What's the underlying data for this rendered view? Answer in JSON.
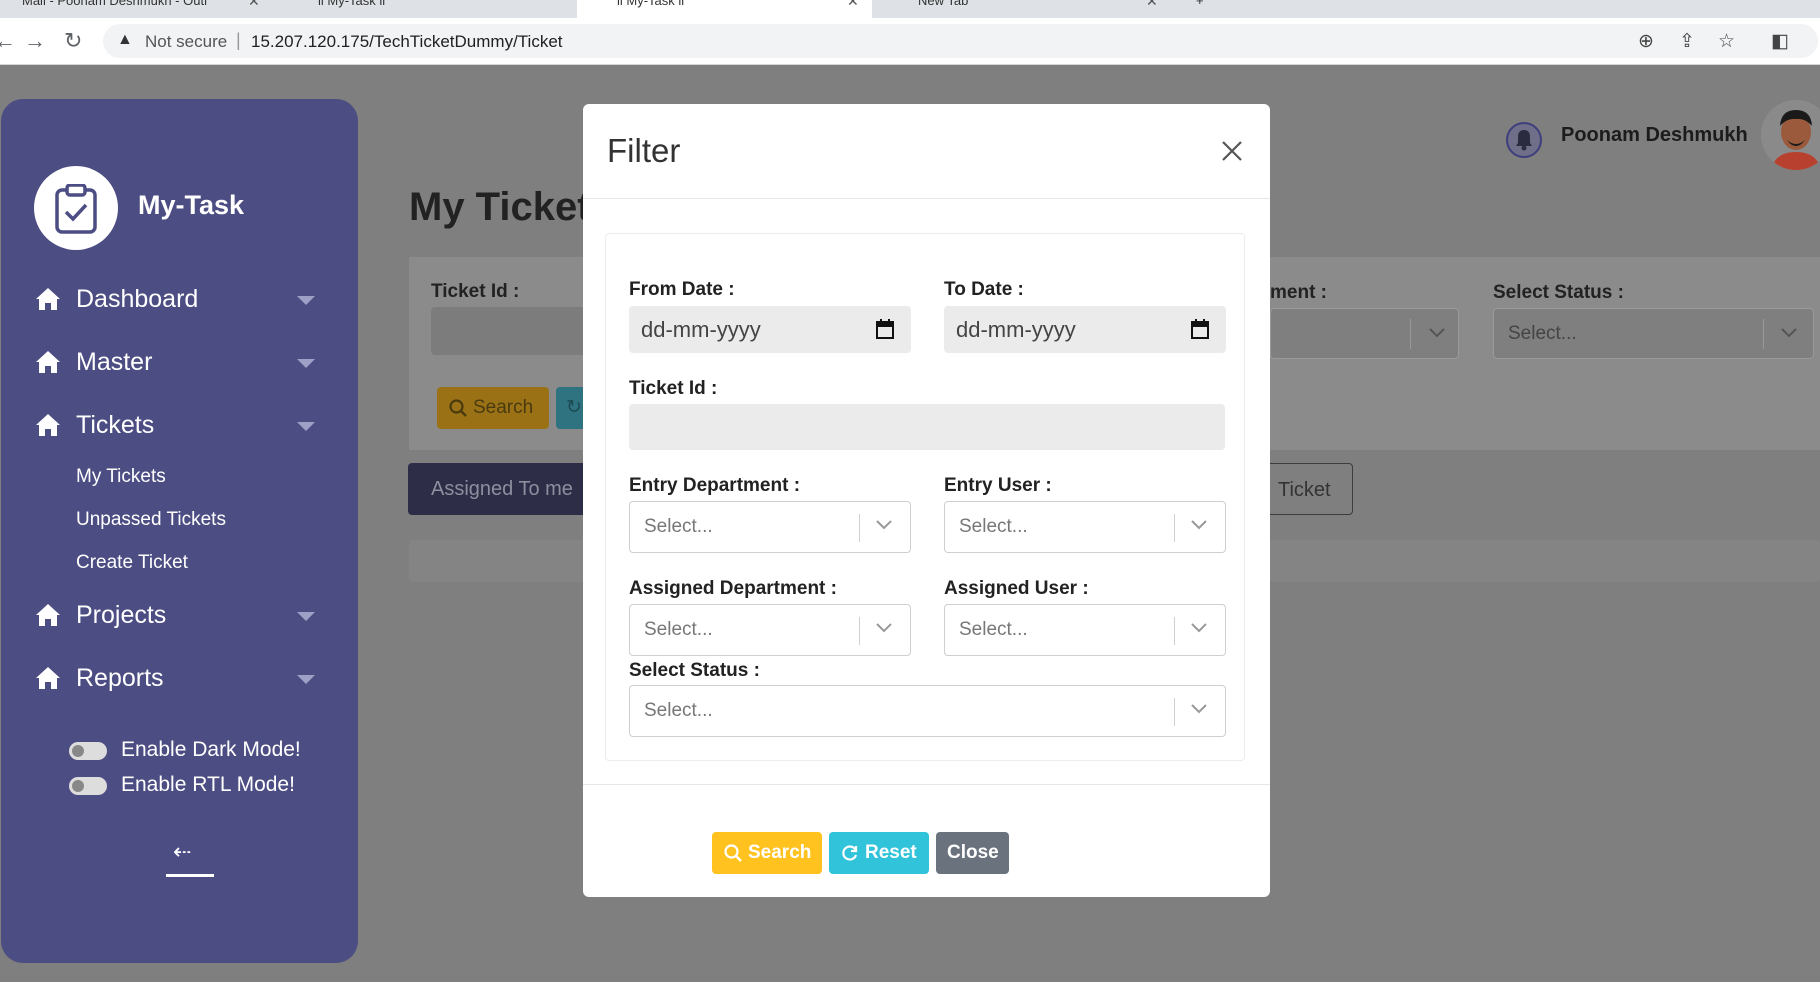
{
  "browser": {
    "tabs": [
      {
        "title": "Mail - Poonam Deshmukh - Outl"
      },
      {
        "title": "ii My-Task ii"
      },
      {
        "title": "ii My-Task ii"
      },
      {
        "title": "New Tab"
      }
    ],
    "address": {
      "security_label": "Not secure",
      "url": "15.207.120.175/TechTicketDummy/Ticket"
    }
  },
  "sidebar": {
    "brand": "My-Task",
    "items": [
      {
        "label": "Dashboard"
      },
      {
        "label": "Master"
      },
      {
        "label": "Tickets"
      },
      {
        "label": "Projects"
      },
      {
        "label": "Reports"
      }
    ],
    "tickets_sub": [
      {
        "label": "My Tickets"
      },
      {
        "label": "Unpassed Tickets"
      },
      {
        "label": "Create Ticket"
      }
    ],
    "dark_mode_label": "Enable Dark Mode!",
    "rtl_mode_label": "Enable RTL Mode!"
  },
  "header": {
    "user_name": "Poonam Deshmukh"
  },
  "page": {
    "title": "My Ticket",
    "ticket_id_label": "Ticket Id :",
    "dept_label_fragment": "ment :",
    "select_status_label": "Select Status :",
    "select_placeholder": "Select...",
    "search_label": "Search",
    "tab_assigned": "Assigned To me",
    "tab_ticket_fragment": "Ticket"
  },
  "modal": {
    "title": "Filter",
    "from_date_label": "From Date :",
    "to_date_label": "To Date :",
    "date_placeholder": "dd-mm-yyyy",
    "ticket_id_label": "Ticket Id :",
    "entry_department_label": "Entry Department :",
    "entry_user_label": "Entry User :",
    "assigned_department_label": "Assigned Department :",
    "assigned_user_label": "Assigned User :",
    "select_status_label": "Select Status :",
    "select_placeholder": "Select...",
    "buttons": {
      "search": "Search",
      "reset": "Reset",
      "close": "Close"
    }
  },
  "colors": {
    "sidebar_bg": "#4c4d83",
    "search_btn": "#ffc21f",
    "reset_btn": "#31c3d9",
    "close_btn": "#6a737d"
  }
}
